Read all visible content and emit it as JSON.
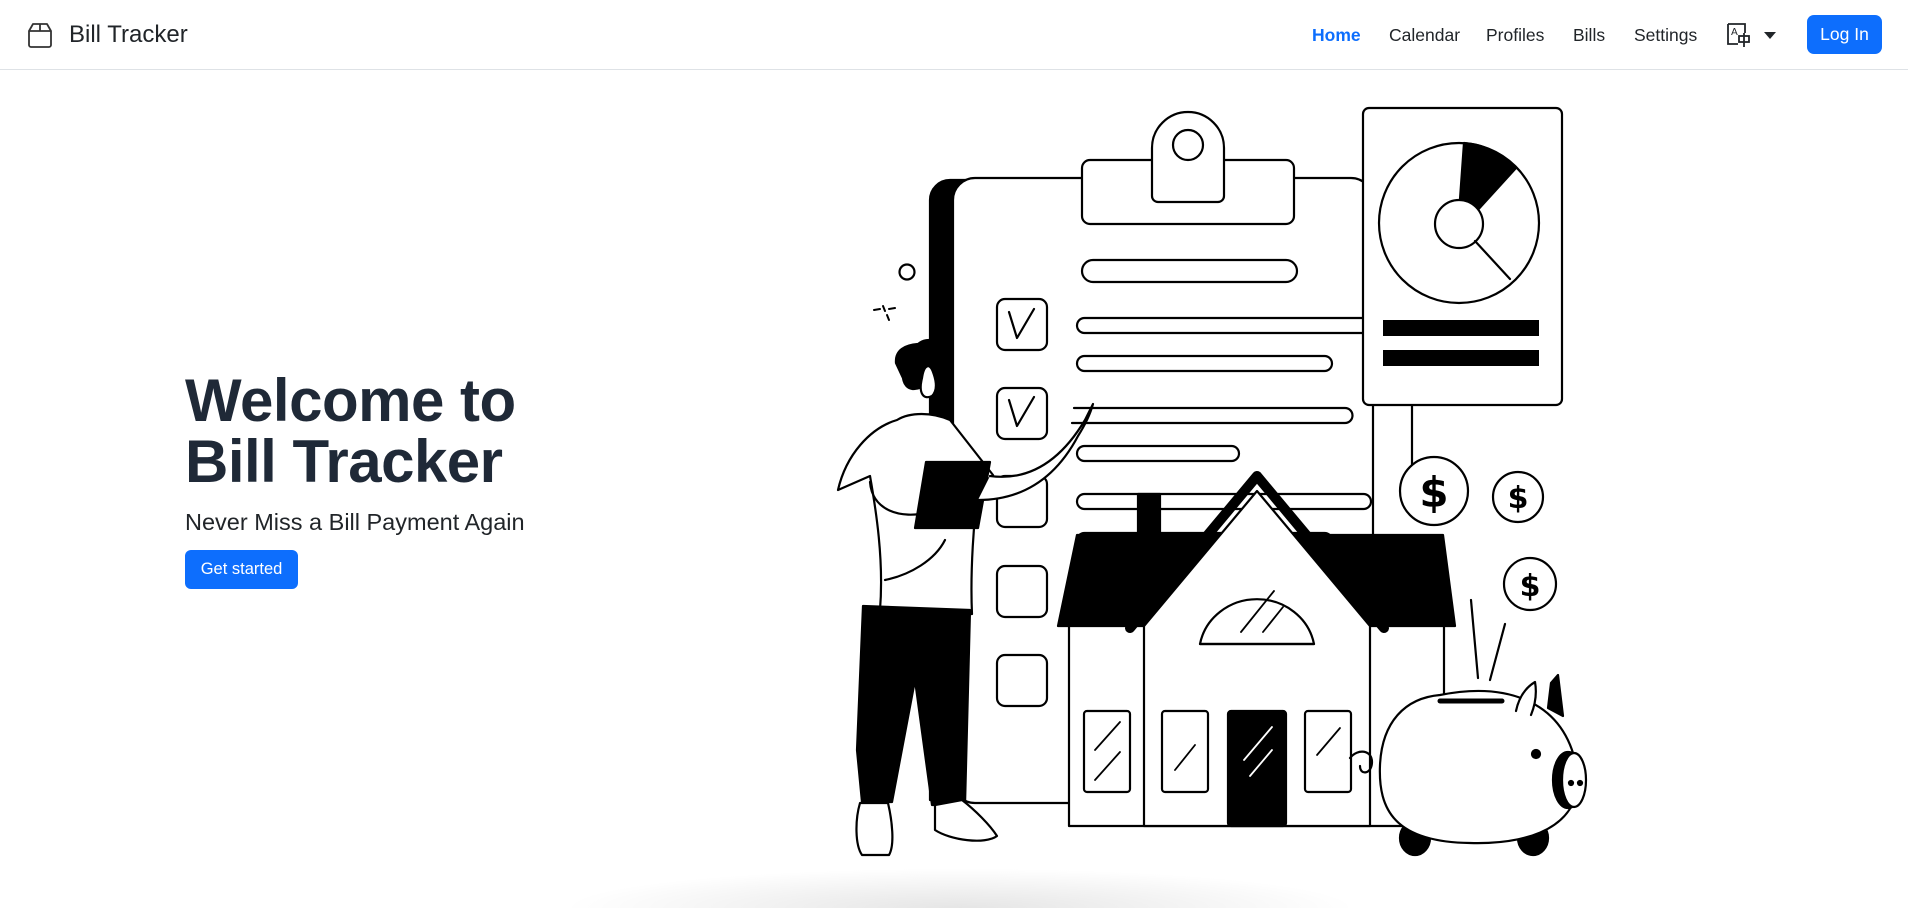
{
  "navbar": {
    "brand": {
      "icon": "box-icon",
      "title": "Bill Tracker"
    },
    "links": [
      {
        "label": "Home",
        "active": true
      },
      {
        "label": "Calendar",
        "active": false
      },
      {
        "label": "Profiles",
        "active": false
      },
      {
        "label": "Bills",
        "active": false
      },
      {
        "label": "Settings",
        "active": false
      }
    ],
    "language_menu": {
      "icon": "translate-icon",
      "dropdown": "caret-down-icon"
    },
    "login_label": "Log In"
  },
  "hero": {
    "title_line1": "Welcome to",
    "title_line2": "Bill Tracker",
    "subtitle": "Never Miss a Bill Payment Again",
    "cta_label": "Get started"
  },
  "illustration": {
    "description": "Person with tablet pointing at a checklist clipboard, pie chart card, house, dollar coins and piggy bank",
    "checklist_checked": [
      true,
      true,
      false,
      false,
      false
    ],
    "coin_symbol": "$"
  },
  "colors": {
    "primary": "#0d6efd",
    "heading": "#1f2937",
    "text": "#212529",
    "border": "#dee2e6"
  }
}
